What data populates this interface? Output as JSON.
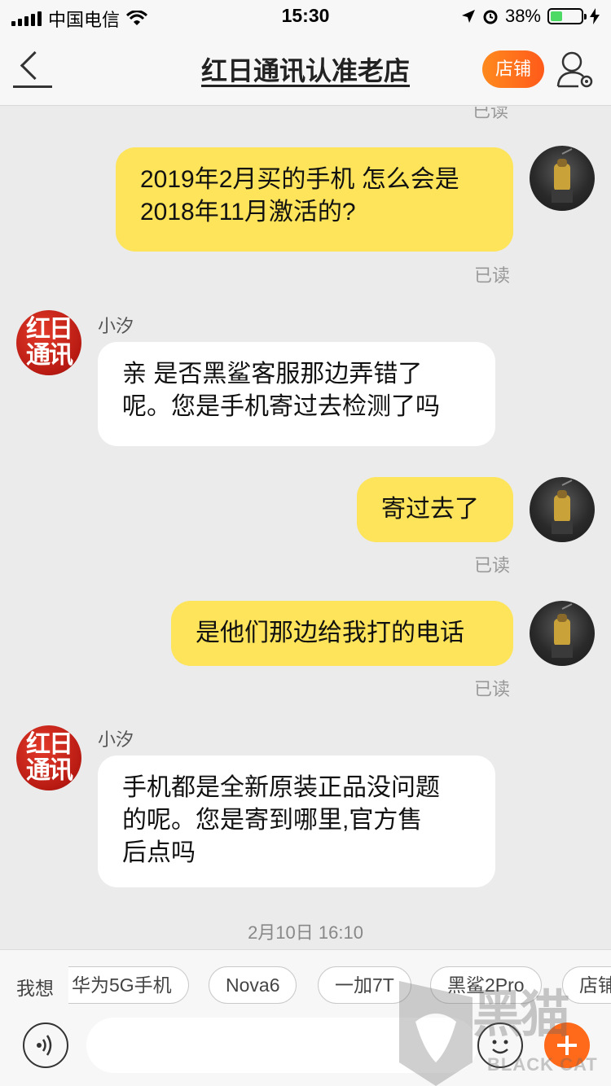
{
  "status_bar": {
    "carrier": "中国电信",
    "time": "15:30",
    "battery": "38%",
    "battery_level": 0.38
  },
  "nav": {
    "title": "红日通讯认准老店",
    "shop_button": "店铺"
  },
  "chat": {
    "top_read": "已读",
    "messages": [
      {
        "side": "me",
        "lines": [
          "2019年2月买的手机 怎么会是",
          "2018年11月激活的?"
        ],
        "status": "已读"
      },
      {
        "side": "them",
        "sender": "小汐",
        "avatar_text": "红日通讯",
        "lines": [
          "亲 是否黑鲨客服那边弄错了",
          "呢。您是手机寄过去检测了吗"
        ]
      },
      {
        "side": "me",
        "lines": [
          "寄过去了"
        ],
        "status": "已读"
      },
      {
        "side": "me",
        "lines": [
          "是他们那边给我打的电话"
        ],
        "status": "已读"
      },
      {
        "side": "them",
        "sender": "小汐",
        "avatar_text": "红日通讯",
        "lines": [
          "手机都是全新原装正品没问题",
          "的呢。您是寄到哪里,官方售",
          "后点吗"
        ]
      }
    ],
    "timestamp": "2月10日 16:10"
  },
  "suggestions": {
    "label": "我想",
    "chips": [
      "华为5G手机",
      "Nova6",
      "一加7T",
      "黑鲨2Pro",
      "店铺"
    ]
  },
  "input": {
    "voice_icon": "voice-icon",
    "emoji_icon": "emoji-icon",
    "plus_icon": "plus-icon"
  },
  "watermark": {
    "text": "黑猫",
    "sub": "BLACK CAT"
  },
  "colors": {
    "my_bubble": "#fde45a",
    "their_bubble": "#ffffff",
    "accent": "#ff6a1a",
    "background": "#ebebeb"
  }
}
